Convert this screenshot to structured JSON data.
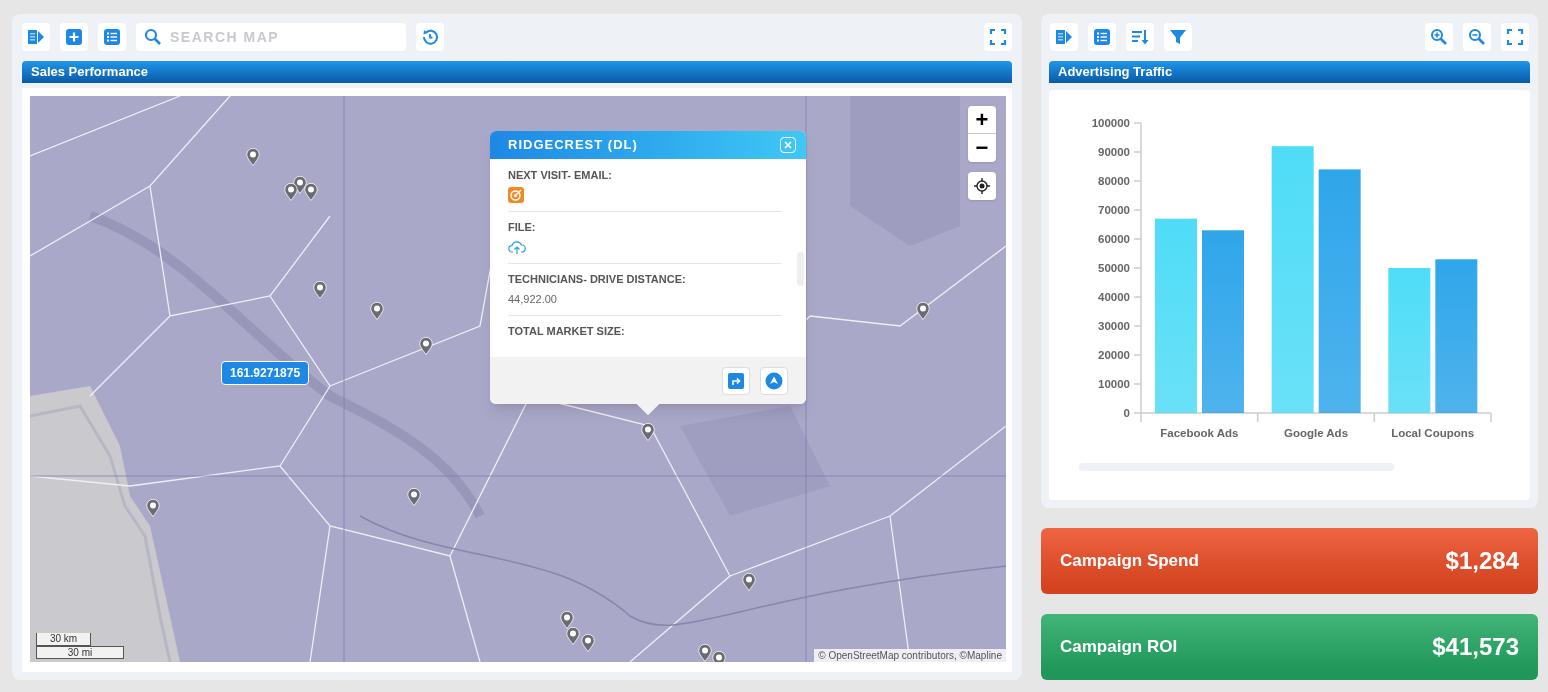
{
  "map_panel": {
    "search": {
      "placeholder": "SEARCH MAP"
    },
    "title": "Sales Performance",
    "map": {
      "kind": "picture",
      "value_label": "161.9271875",
      "popup": {
        "title": "RIDGECREST (DL)",
        "fields": [
          {
            "label": "NEXT VISIT- EMAIL:",
            "kind": "email-icon"
          },
          {
            "label": "FILE:",
            "kind": "upload-icon"
          },
          {
            "label": "TECHNICIANS- DRIVE DISTANCE:",
            "kind": "text",
            "value": "44,922.00"
          },
          {
            "label": "TOTAL MARKET SIZE:",
            "kind": "empty"
          }
        ]
      },
      "zoom_in": "+",
      "zoom_out": "−",
      "scale": [
        "30 km",
        "30 mi"
      ],
      "attribution": "© OpenStreetMap contributors, ©Mapline"
    }
  },
  "chart_panel": {
    "title": "Advertising Traffic",
    "chart_data": {
      "type": "bar",
      "categories": [
        "Facebook Ads",
        "Google Ads",
        "Local Coupons"
      ],
      "series": [
        {
          "color": "#4fdcf7",
          "values": [
            67000,
            92000,
            50000
          ]
        },
        {
          "color": "#2fa6ea",
          "values": [
            63000,
            84000,
            53000
          ]
        }
      ],
      "ylim": [
        0,
        100000
      ],
      "yticks": [
        0,
        10000,
        20000,
        30000,
        40000,
        50000,
        60000,
        70000,
        80000,
        90000,
        100000
      ]
    }
  },
  "metrics": [
    {
      "label": "Campaign Spend",
      "value": "$1,284",
      "color": "#ec4a22"
    },
    {
      "label": "Campaign ROI",
      "value": "$41,573",
      "color": "#22a862"
    }
  ]
}
